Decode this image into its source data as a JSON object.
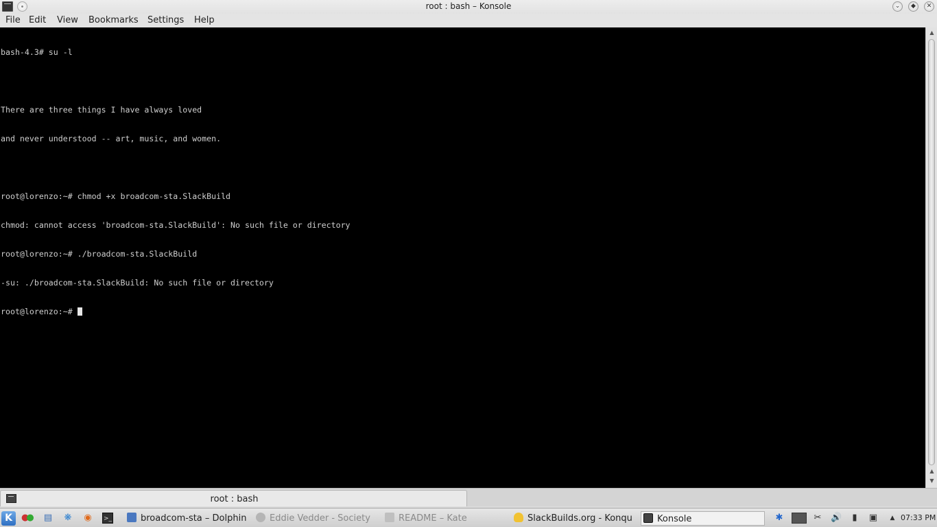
{
  "window": {
    "title": "root : bash – Konsole"
  },
  "menu": {
    "items": [
      "File",
      "Edit",
      "View",
      "Bookmarks",
      "Settings",
      "Help"
    ]
  },
  "terminal": {
    "lines": [
      "bash-4.3# su -l",
      "",
      "There are three things I have always loved",
      "and never understood -- art, music, and women.",
      "",
      "root@lorenzo:~# chmod +x broadcom-sta.SlackBuild",
      "chmod: cannot access 'broadcom-sta.SlackBuild': No such file or directory",
      "root@lorenzo:~# ./broadcom-sta.SlackBuild",
      "-su: ./broadcom-sta.SlackBuild: No such file or directory",
      "root@lorenzo:~# "
    ]
  },
  "tabs": [
    {
      "label": "root : bash"
    }
  ],
  "taskbar": {
    "tasks": [
      {
        "label": "broadcom-sta – Dolphin",
        "icon": "dolphin-icon",
        "active": false
      },
      {
        "label": "Eddie Vedder - Society -",
        "icon": "music-icon",
        "active": false,
        "dimmed": true
      },
      {
        "label": "README – Kate",
        "icon": "kate-icon",
        "active": false,
        "dimmed": true
      },
      {
        "label": "SlackBuilds.org - Konqu",
        "icon": "tux-icon",
        "active": false
      },
      {
        "label": "Konsole",
        "icon": "konsole-icon",
        "active": true
      }
    ],
    "clock": "07:33 PM"
  },
  "colors": {
    "terminal_bg": "#000000",
    "terminal_fg": "#cfcfcf",
    "panel": "#dcdcdc"
  }
}
